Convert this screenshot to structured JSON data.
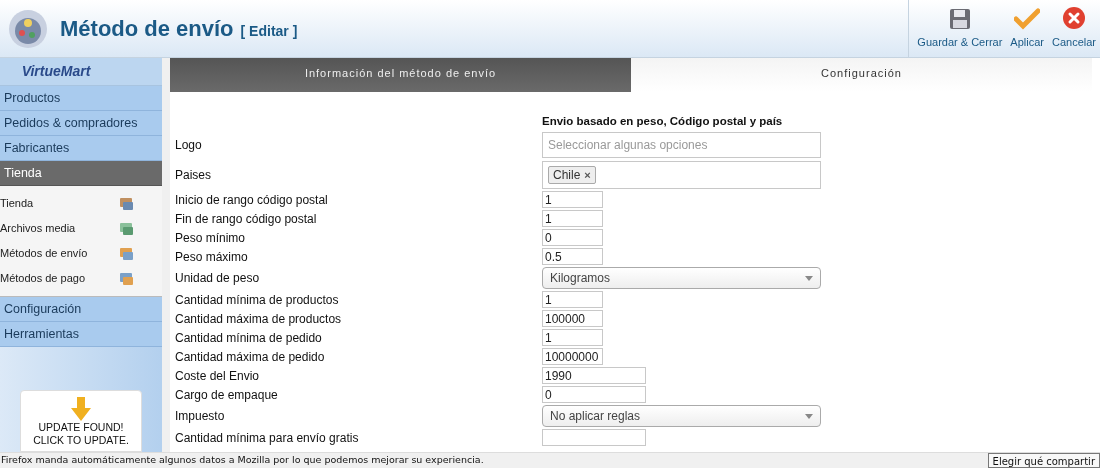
{
  "header": {
    "title": "Método de envío",
    "subtitle": "[ Editar ]"
  },
  "toolbar": [
    {
      "label": "Guardar & Cerrar",
      "kind": "save"
    },
    {
      "label": "Aplicar",
      "kind": "apply"
    },
    {
      "label": "Cancelar",
      "kind": "cancel"
    }
  ],
  "sidebar": {
    "logo": "VirtueMart",
    "menu": [
      {
        "label": "Productos",
        "expanded": false
      },
      {
        "label": "Pedidos & compradores",
        "expanded": false
      },
      {
        "label": "Fabricantes",
        "expanded": false
      },
      {
        "label": "Tienda",
        "expanded": true,
        "children": [
          {
            "label": "Tienda",
            "kind": "store"
          },
          {
            "label": "Archivos media",
            "kind": "media"
          },
          {
            "label": "Métodos de envío",
            "kind": "shipping"
          },
          {
            "label": "Métodos de pago",
            "kind": "payment"
          }
        ]
      },
      {
        "label": "Configuración",
        "expanded": false
      },
      {
        "label": "Herramientas",
        "expanded": false
      }
    ],
    "update": {
      "line1": "UPDATE FOUND!",
      "line2": "CLICK TO UPDATE."
    }
  },
  "tabs": [
    {
      "label": "Información del método de envío",
      "selected": false
    },
    {
      "label": "Configuración",
      "selected": true
    }
  ],
  "form": {
    "heading": "Envio basado en peso, Código postal y país",
    "fields": [
      {
        "label": "Logo",
        "kind": "multi",
        "placeholder": "Seleccionar algunas opciones"
      },
      {
        "label": "Paises",
        "kind": "tags",
        "tags": [
          "Chile"
        ],
        "remove": "×"
      },
      {
        "label": "Inicio de rango código postal",
        "kind": "short",
        "value": "1"
      },
      {
        "label": "Fin de rango código postal",
        "kind": "short",
        "value": "1"
      },
      {
        "label": "Peso mínimo",
        "kind": "short",
        "value": "0"
      },
      {
        "label": "Peso máximo",
        "kind": "short",
        "value": "0.5"
      },
      {
        "label": "Unidad de peso",
        "kind": "select",
        "value": "Kilogramos"
      },
      {
        "label": "Cantidad mínima de productos",
        "kind": "short",
        "value": "1"
      },
      {
        "label": "Cantidad máxima de productos",
        "kind": "short",
        "value": "100000"
      },
      {
        "label": "Cantidad mínima de pedido",
        "kind": "short",
        "value": "1"
      },
      {
        "label": "Cantidad máxima de pedido",
        "kind": "short",
        "value": "10000000"
      },
      {
        "label": "Coste del Envio",
        "kind": "medium",
        "value": "1990"
      },
      {
        "label": "Cargo de empaque",
        "kind": "medium",
        "value": "0"
      },
      {
        "label": "Impuesto",
        "kind": "select",
        "value": "No aplicar reglas"
      },
      {
        "label": "Cantidad mínima para envío gratis",
        "kind": "medium"
      }
    ]
  },
  "notification": {
    "message": "Firefox manda automáticamente algunos datos a Mozilla por lo que podemos mejorar su experiencia.",
    "button": "Elegir qué compartir"
  }
}
